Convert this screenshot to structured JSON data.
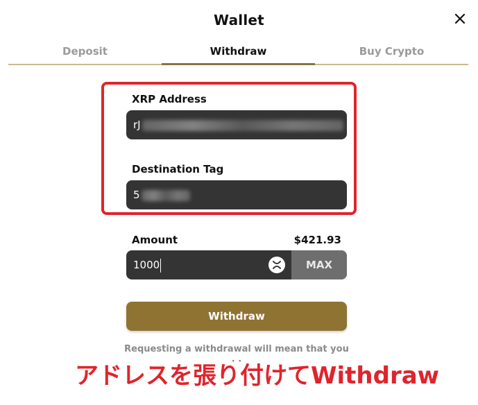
{
  "modal": {
    "title": "Wallet",
    "close_icon": "close-icon"
  },
  "tabs": [
    {
      "label": "Deposit",
      "active": false
    },
    {
      "label": "Withdraw",
      "active": true
    },
    {
      "label": "Buy Crypto",
      "active": false
    }
  ],
  "form": {
    "address_label": "XRP Address",
    "address_value": "rJ",
    "destination_tag_label": "Destination Tag",
    "destination_tag_value": "5",
    "amount_label": "Amount",
    "balance": "$421.93",
    "amount_value": "1000",
    "max_label": "MAX",
    "submit_label": "Withdraw",
    "note_line1": "Requesting a withdrawal will mean that you",
    "note_line2": "·  ·"
  },
  "annotation": {
    "caption": "アドレスを張り付けてWithdraw",
    "highlight_color": "#e0242c"
  },
  "colors": {
    "accent": "#8f7333",
    "input_bg": "#343434",
    "tab_active_line": "#8a7340"
  }
}
